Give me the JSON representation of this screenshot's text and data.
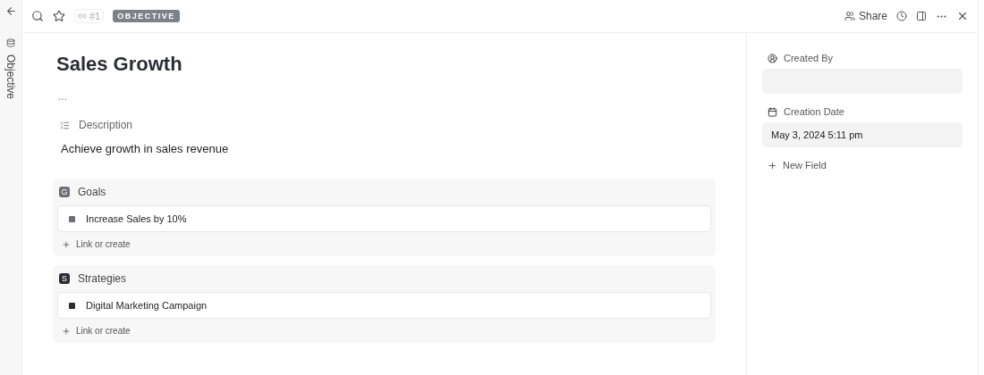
{
  "sidebar": {
    "label": "Objective"
  },
  "toolbar": {
    "id": "#1",
    "type_badge": "OBJECTIVE",
    "share": "Share"
  },
  "title": "Sales Growth",
  "more": "...",
  "description": {
    "label": "Description",
    "text": "Achieve growth in sales revenue"
  },
  "sections": [
    {
      "letter": "G",
      "name": "Goals",
      "color": "#6b6f76",
      "items": [
        "Increase Sales by 10%"
      ],
      "add": "Link or create"
    },
    {
      "letter": "S",
      "name": "Strategies",
      "color": "#2a2e34",
      "items": [
        "Digital Marketing Campaign"
      ],
      "add": "Link or create"
    }
  ],
  "fields": [
    {
      "kind": "person",
      "label": "Created By"
    },
    {
      "kind": "date",
      "label": "Creation Date",
      "value": "May 3, 2024 5:11 pm"
    }
  ],
  "new_field": "New Field"
}
